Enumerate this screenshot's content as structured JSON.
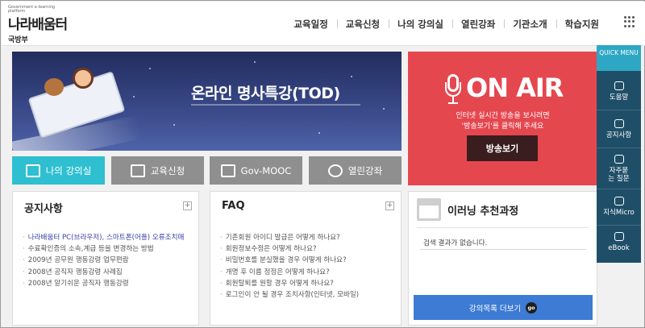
{
  "header": {
    "logo_subtitle": "Government e-learning platform",
    "logo_text": "나라배움터",
    "ministry": "국방부",
    "nav": [
      "교육일정",
      "교육신청",
      "나의 강의실",
      "열린강좌",
      "기관소개",
      "학습지원"
    ],
    "grid_icon": "grid-icon"
  },
  "banner_tod": {
    "title": "온라인 명사특강(TOD)"
  },
  "banner_air": {
    "title": "ON AIR",
    "desc_line1": "인터넷 실시간 방송을 보시려면",
    "desc_line2": "'방송보기'를 클릭해 주세요",
    "button": "방송보기",
    "accent": "#e5474f"
  },
  "quick_buttons": [
    {
      "label": "나의 강의실",
      "icon": "monitor-icon"
    },
    {
      "label": "교육신청",
      "icon": "edit-icon"
    },
    {
      "label": "Gov-MOOC",
      "icon": "laptop-icon"
    },
    {
      "label": "열린강좌",
      "icon": "globe-icon"
    }
  ],
  "notice": {
    "title": "공지사항",
    "items": [
      "나라배움터 PC(브라우저), 스마트폰(어플) 오류조치매",
      "수료확인증의 소속,계급 등을 변경하는 방법",
      "2009년 공무원 행동강령 업무편람",
      "2008년 공직자 행동강령 사례집",
      "2008년 알기쉬운 공직자 행동강령"
    ]
  },
  "faq": {
    "title": "FAQ",
    "items": [
      "기존회원 아이디 발급은 어떻게 하나요?",
      "회원정보수정은 어떻게 하나요?",
      "비밀번호를 분실했을 경우 어떻게 하나요?",
      "개명 후 이름 정정은 어떻게 하나요?",
      "회원탈퇴를 원할 경우 어떻게 하나요?",
      "로그인이 안 될 경우 조치사항(인터넷, 모바일)"
    ]
  },
  "elearning": {
    "title": "이러닝 추천과정",
    "empty": "검색 결과가 없습니다.",
    "button": "강의목록 더보기",
    "go": "go"
  },
  "quick_menu": {
    "header": "QUICK MENU",
    "items": [
      {
        "label": "도움말",
        "icon": "chat-icon"
      },
      {
        "label": "공지사항",
        "icon": "speaker-icon"
      },
      {
        "label": "자주묻는 질문",
        "icon": "question-icon"
      },
      {
        "label": "지식Micro",
        "icon": "graduation-cap-icon"
      },
      {
        "label": "eBook",
        "icon": "book-icon"
      }
    ]
  }
}
